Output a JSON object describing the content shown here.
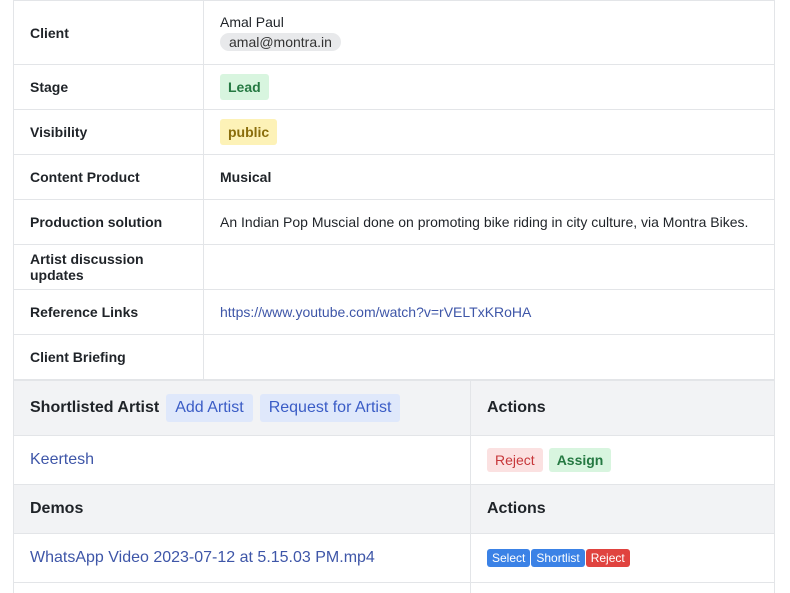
{
  "details": {
    "client_label": "Client",
    "client_name": "Amal Paul",
    "client_email": "amal@montra.in",
    "stage_label": "Stage",
    "stage_value": "Lead",
    "visibility_label": "Visibility",
    "visibility_value": "public",
    "content_product_label": "Content Product",
    "content_product_value": "Musical",
    "production_solution_label": "Production solution",
    "production_solution_value": "An Indian Pop Muscial done on promoting bike riding in city culture, via Montra Bikes.",
    "artist_updates_label": "Artist discussion updates",
    "artist_updates_value": "",
    "reference_links_label": "Reference Links",
    "reference_links_value": "https://www.youtube.com/watch?v=rVELTxKRoHA",
    "client_briefing_label": "Client Briefing",
    "client_briefing_value": ""
  },
  "shortlist": {
    "title": "Shortlisted Artist",
    "add_artist_label": "Add Artist",
    "request_artist_label": "Request for Artist",
    "actions_label": "Actions",
    "artists": [
      {
        "name": "Keertesh",
        "reject_label": "Reject",
        "assign_label": "Assign"
      }
    ]
  },
  "demos": {
    "title": "Demos",
    "actions_label": "Actions",
    "items": [
      {
        "name": "WhatsApp Video 2023-07-12 at 5.15.03 PM.mp4",
        "select_label": "Select",
        "shortlist_label": "Shortlist",
        "reject_label": "Reject"
      }
    ]
  },
  "colors": {
    "link": "#3e56a8",
    "green_badge_bg": "#d8f5df",
    "yellow_badge_bg": "#fdf2b7",
    "blue_button": "#3b82e6",
    "red_button": "#e0433f"
  }
}
